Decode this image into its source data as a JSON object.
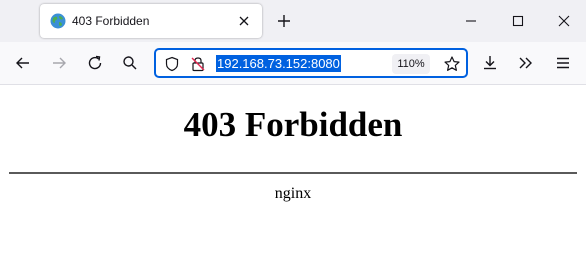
{
  "tab": {
    "title": "403 Forbidden",
    "favicon": "globe-icon"
  },
  "toolbar": {
    "url": "192.168.73.152:8080",
    "zoom": "110%"
  },
  "page": {
    "heading": "403 Forbidden",
    "server": "nginx"
  },
  "colors": {
    "accent": "#0061e0",
    "tabstrip_bg": "#f0f0f4",
    "toolbar_bg": "#f9f9fb"
  }
}
